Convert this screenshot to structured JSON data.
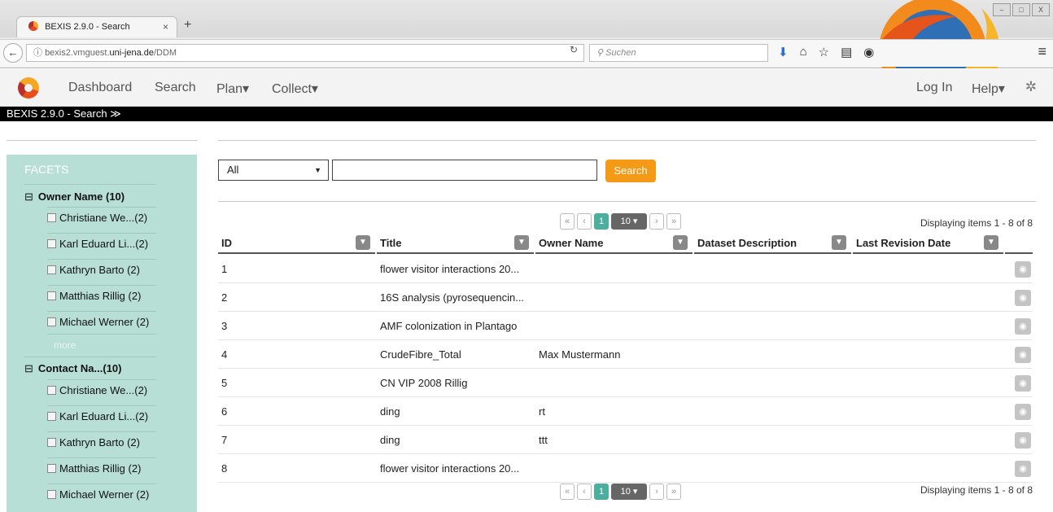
{
  "browser": {
    "tab_title": "BEXIS 2.9.0 - Search",
    "tab_close": "×",
    "new_tab": "+",
    "url_prefix": "bexis2.vmguest.",
    "url_host": "uni-jena.de",
    "url_path": "/DDM",
    "search_placeholder": "Suchen",
    "window_controls": [
      "–",
      "□",
      "X"
    ]
  },
  "app_nav": {
    "items_left": [
      "Dashboard",
      "Search",
      "Plan",
      "Collect"
    ],
    "plan_label": "Plan▾",
    "collect_label": "Collect▾",
    "login": "Log In",
    "help": "Help▾"
  },
  "context_bar": {
    "label": "BEXIS 2.9.0 - Search ≫"
  },
  "facets": {
    "title": "FACETS",
    "groups": [
      {
        "label": "Owner Name (10)",
        "items": [
          "Christiane We...(2)",
          "Karl Eduard Li...(2)",
          "Kathryn Barto (2)",
          "Matthias Rillig (2)",
          "Michael Werner (2)"
        ],
        "more": "more"
      },
      {
        "label": "Contact Na...(10)",
        "items": [
          "Christiane We...(2)",
          "Karl Eduard Li...(2)",
          "Kathryn Barto (2)",
          "Matthias Rillig (2)",
          "Michael Werner (2)"
        ]
      }
    ]
  },
  "search": {
    "select_value": "All",
    "input_value": "",
    "button_label": "Search"
  },
  "pager": {
    "first": "«",
    "prev": "‹",
    "current": "1",
    "page_size": "10 ▾",
    "next": "›",
    "last": "»",
    "display_info": "Displaying items 1 - 8 of 8"
  },
  "grid": {
    "columns": [
      "ID",
      "Title",
      "Owner Name",
      "Dataset Description",
      "Last Revision Date"
    ],
    "rows": [
      {
        "id": "1",
        "title": "flower visitor interactions 20...",
        "owner": "",
        "desc": "",
        "date": ""
      },
      {
        "id": "2",
        "title": "16S analysis (pyrosequencin...",
        "owner": "",
        "desc": "",
        "date": ""
      },
      {
        "id": "3",
        "title": "AMF colonization in Plantago",
        "owner": "",
        "desc": "",
        "date": ""
      },
      {
        "id": "4",
        "title": "CrudeFibre_Total",
        "owner": "Max Mustermann",
        "desc": "",
        "date": ""
      },
      {
        "id": "5",
        "title": "CN VIP 2008 Rillig",
        "owner": "",
        "desc": "",
        "date": ""
      },
      {
        "id": "6",
        "title": "ding",
        "owner": "rt",
        "desc": "",
        "date": ""
      },
      {
        "id": "7",
        "title": "ding",
        "owner": "ttt",
        "desc": "",
        "date": ""
      },
      {
        "id": "8",
        "title": "flower visitor interactions 20...",
        "owner": "",
        "desc": "",
        "date": ""
      }
    ]
  },
  "colors": {
    "accent": "#f59a16",
    "sidebar": "#b8dfd6",
    "active_page": "#4cae9c"
  }
}
